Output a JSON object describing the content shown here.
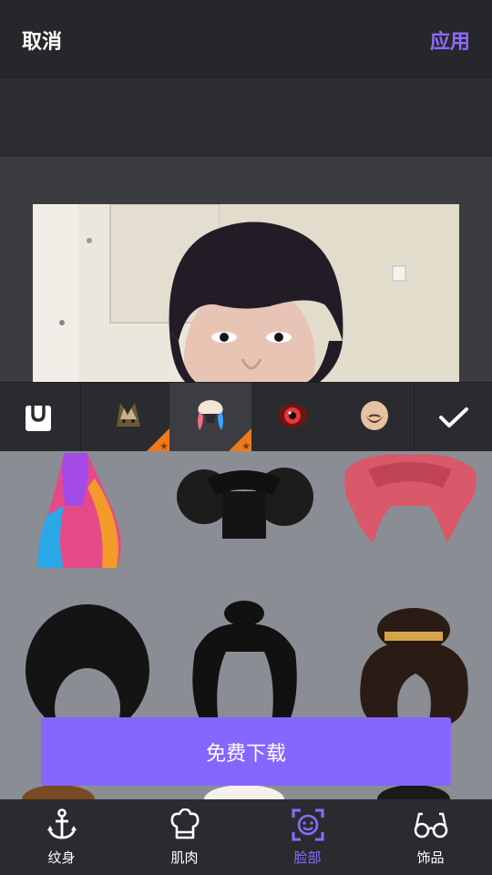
{
  "header": {
    "cancel_label": "取消",
    "apply_label": "应用"
  },
  "toolbar": {
    "items": [
      {
        "name": "store",
        "icon": "shopping-bag-icon"
      },
      {
        "name": "cat-ears",
        "icon": "cat-ears-sticker-icon",
        "premium": true
      },
      {
        "name": "twin-tails",
        "icon": "colored-twin-tails-icon",
        "premium": true,
        "selected": true
      },
      {
        "name": "red-eye",
        "icon": "red-eye-icon"
      },
      {
        "name": "beard",
        "icon": "beard-icon"
      }
    ],
    "confirm_icon": "checkmark-icon"
  },
  "hairstyles": [
    {
      "name": "rainbow-ponytail"
    },
    {
      "name": "black-afro-buns"
    },
    {
      "name": "pink-twin-tails"
    },
    {
      "name": "black-afro"
    },
    {
      "name": "black-long-updo"
    },
    {
      "name": "japanese-updo"
    }
  ],
  "download_label": "免费下载",
  "bottom_nav": {
    "items": [
      {
        "label": "纹身",
        "icon": "anchor-icon",
        "active": false
      },
      {
        "label": "肌肉",
        "icon": "chef-hat-icon",
        "active": false
      },
      {
        "label": "脸部",
        "icon": "face-scan-icon",
        "active": true
      },
      {
        "label": "饰品",
        "icon": "glasses-icon",
        "active": false
      }
    ]
  },
  "colors": {
    "accent": "#8566ff",
    "premium_corner": "#f07a1a",
    "background": "#2a2b2f"
  }
}
